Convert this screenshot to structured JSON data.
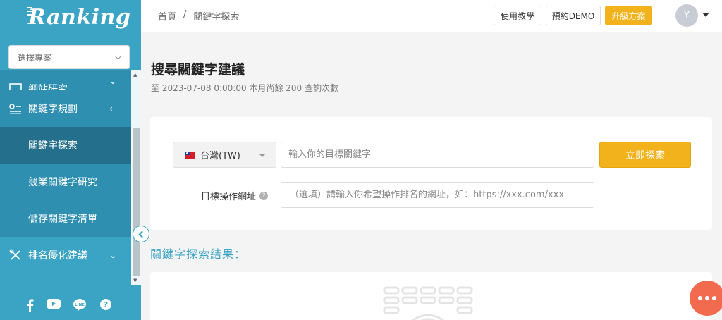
{
  "brand": {
    "name": "Ranking"
  },
  "sidebar": {
    "project_select": {
      "placeholder": "選擇專案"
    },
    "items": [
      {
        "label": "網站研究",
        "icon": "monitor-icon"
      },
      {
        "label": "關鍵字規劃",
        "icon": "keyword-plan-icon"
      },
      {
        "label": "關鍵字探索"
      },
      {
        "label": "競業關鍵字研究"
      },
      {
        "label": "儲存關鍵字清單"
      },
      {
        "label": "排名優化建議",
        "icon": "tools-icon"
      }
    ],
    "social": [
      "facebook-icon",
      "youtube-icon",
      "line-icon",
      "help-icon"
    ]
  },
  "header": {
    "breadcrumb": [
      "首頁",
      "/",
      "關鍵字探索"
    ],
    "tutorial_label": "使用教學",
    "demo_label": "預約DEMO",
    "upgrade_label": "升級方案",
    "avatar_initial": "Y"
  },
  "main": {
    "title": "搜尋關鍵字建議",
    "subtitle": "至 2023-07-08 0:00:00 本月尚餘 200 查詢次數",
    "country": "台灣(TW)",
    "keyword_placeholder": "輸入你的目標關鍵字",
    "search_label": "立即探索",
    "url_label": "目標操作網址",
    "url_placeholder": "（選填）請輸入你希望操作排名的網址，如：https://xxx.com/xxx",
    "results_title": "關鍵字探索結果："
  },
  "colors": {
    "sidebar": "#3ba3c4",
    "accent": "#f2b21b",
    "chat": "#f36b4f"
  }
}
